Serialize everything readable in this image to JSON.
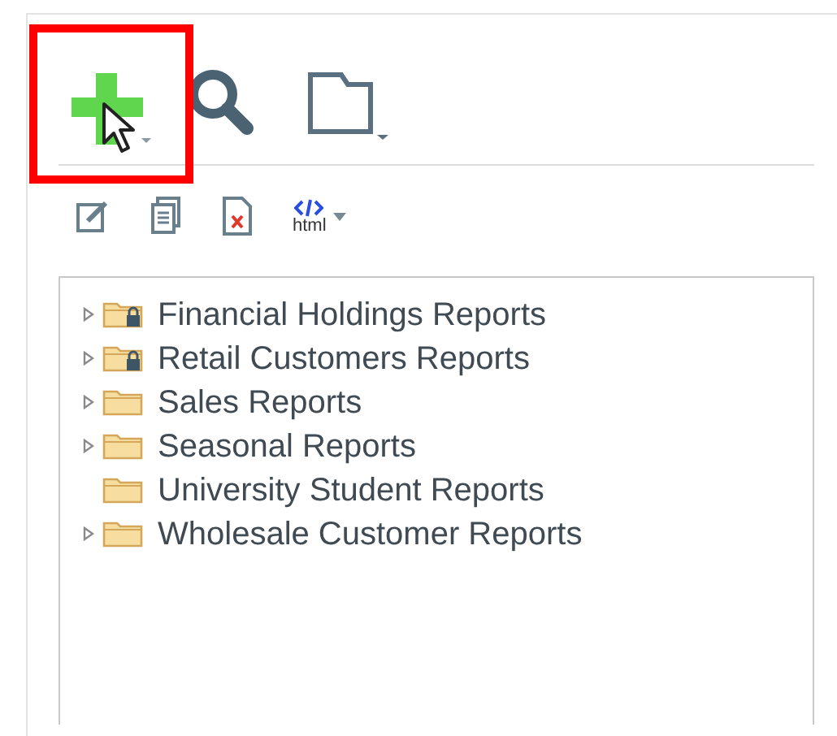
{
  "html_button": {
    "label": "html"
  },
  "tree": [
    {
      "label": "Financial Holdings Reports",
      "expandable": true,
      "locked": true
    },
    {
      "label": "Retail Customers Reports",
      "expandable": true,
      "locked": true
    },
    {
      "label": "Sales Reports",
      "expandable": true,
      "locked": false
    },
    {
      "label": "Seasonal Reports",
      "expandable": true,
      "locked": false
    },
    {
      "label": "University Student Reports",
      "expandable": false,
      "locked": false
    },
    {
      "label": "Wholesale Customer Reports",
      "expandable": true,
      "locked": false
    }
  ]
}
